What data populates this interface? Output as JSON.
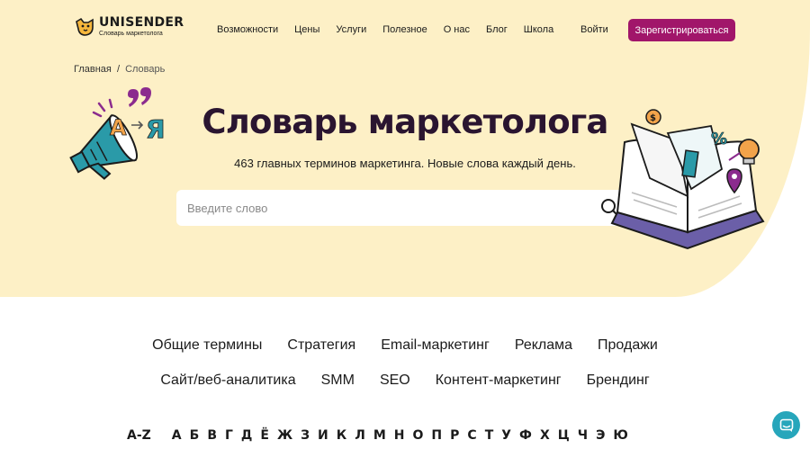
{
  "header": {
    "logo_name": "UNISENDER",
    "logo_tagline": "Словарь маркетолога",
    "nav": [
      "Возможности",
      "Цены",
      "Услуги",
      "Полезное",
      "О нас",
      "Блог",
      "Школа"
    ],
    "login_label": "Войти",
    "register_label": "Зарегистрироваться"
  },
  "breadcrumb": {
    "home": "Главная",
    "separator": "/",
    "current": "Словарь"
  },
  "hero": {
    "title": "Словарь маркетолога",
    "subtitle": "463 главных терминов маркетинга. Новые слова каждый день.",
    "search_placeholder": "Введите слово",
    "illus_letter_a": "А",
    "illus_letter_ya": "Я"
  },
  "categories": {
    "row1": [
      "Общие термины",
      "Стратегия",
      "Email-маркетинг",
      "Реклама",
      "Продажи"
    ],
    "row2": [
      "Сайт/веб-аналитика",
      "SMM",
      "SEO",
      "Контент-маркетинг",
      "Брендинг"
    ]
  },
  "alphabet": {
    "all_label": "A-Z",
    "letters": [
      "А",
      "Б",
      "В",
      "Г",
      "Д",
      "Ё",
      "Ж",
      "З",
      "И",
      "К",
      "Л",
      "М",
      "Н",
      "О",
      "П",
      "Р",
      "С",
      "Т",
      "У",
      "Ф",
      "Х",
      "Ц",
      "Ч",
      "Э",
      "Ю"
    ]
  },
  "icons": {
    "logo": "dog-logo-icon",
    "search": "search-icon",
    "chat": "chat-icon"
  },
  "colors": {
    "hero_bg": "#fdf0c6",
    "accent": "#a1166a",
    "chat": "#27a6bb",
    "title": "#2a1530"
  }
}
